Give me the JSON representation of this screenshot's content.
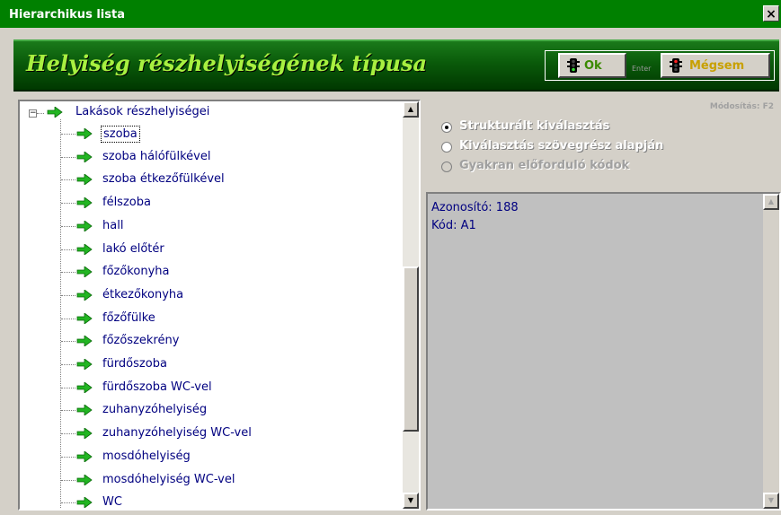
{
  "window": {
    "title": "Hierarchikus lista",
    "close_glyph": "×"
  },
  "banner": {
    "heading": "Helyiség részhelyiségének típusa",
    "ok_label": "Ok",
    "enter_hint": "Enter",
    "cancel_label": "Mégsem"
  },
  "tree": {
    "root_label": "Lakások részhelyiségei",
    "expander_glyph": "−",
    "selected_index": 0,
    "items": [
      "szoba",
      "szoba hálófülkével",
      "szoba étkezőfülkével",
      "félszoba",
      "hall",
      "lakó előtér",
      "főzőkonyha",
      "étkezőkonyha",
      "főzőfülke",
      "főzőszekrény",
      "fürdőszoba",
      "fürdőszoba WC-vel",
      "zuhanyzóhelyiség",
      "zuhanyzóhelyiség WC-vel",
      "mosdóhelyiség",
      "mosdóhelyiség WC-vel",
      "WC"
    ],
    "arrow_color": "#22b522"
  },
  "options": {
    "modify_hint": "Módosítás: F2",
    "radios": [
      {
        "label": "Strukturált kiválasztás",
        "selected": true,
        "enabled": true
      },
      {
        "label": "Kiválasztás szövegrész alapján",
        "selected": false,
        "enabled": true
      },
      {
        "label": "Gyakran előforduló kódok",
        "selected": false,
        "enabled": false
      }
    ]
  },
  "info": {
    "line1": "Azonosító: 188",
    "line2": "Kód: A1"
  },
  "scrollbars": {
    "up_glyph": "▲",
    "down_glyph": "▼"
  }
}
